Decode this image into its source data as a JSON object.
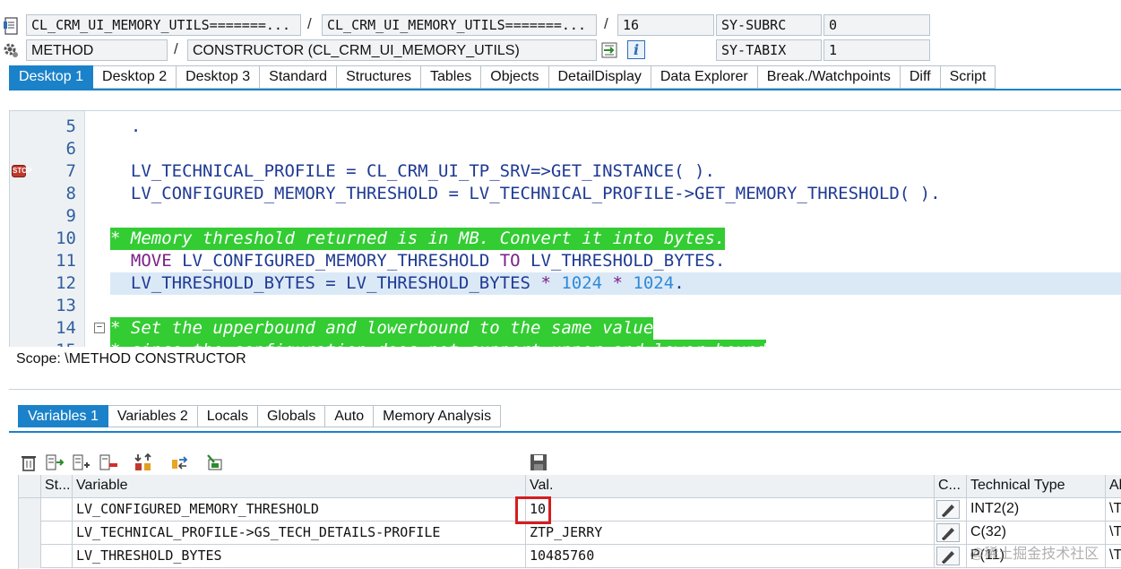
{
  "header": {
    "row1": {
      "program": "CL_CRM_UI_MEMORY_UTILS=======...",
      "include": "CL_CRM_UI_MEMORY_UTILS=======...",
      "line": "16",
      "sysvar1_name": "SY-SUBRC",
      "sysvar1_value": "0"
    },
    "row2": {
      "event_type": "METHOD",
      "event": "CONSTRUCTOR (CL_CRM_UI_MEMORY_UTILS)",
      "sysvar2_name": "SY-TABIX",
      "sysvar2_value": "1",
      "info_label": "i"
    },
    "separator": "/"
  },
  "desktop_tabs": [
    {
      "label": "Desktop 1",
      "active": true
    },
    {
      "label": "Desktop 2"
    },
    {
      "label": "Desktop 3"
    },
    {
      "label": "Standard"
    },
    {
      "label": "Structures"
    },
    {
      "label": "Tables"
    },
    {
      "label": "Objects"
    },
    {
      "label": "DetailDisplay"
    },
    {
      "label": "Data Explorer"
    },
    {
      "label": "Break./Watchpoints"
    },
    {
      "label": "Diff"
    },
    {
      "label": "Script"
    }
  ],
  "code": {
    "lines": [
      {
        "num": "5",
        "text": "  ."
      },
      {
        "num": "6",
        "text": ""
      },
      {
        "num": "7",
        "text": "  LV_TECHNICAL_PROFILE = CL_CRM_UI_TP_SRV=>GET_INSTANCE( )."
      },
      {
        "num": "8",
        "text": "  LV_CONFIGURED_MEMORY_THRESHOLD = LV_TECHNICAL_PROFILE->GET_MEMORY_THRESHOLD( )."
      },
      {
        "num": "9",
        "text": ""
      },
      {
        "num": "10",
        "text": "* Memory threshold returned is in MB. Convert it into bytes."
      },
      {
        "num": "11",
        "kw1": "MOVE",
        "mid": " LV_CONFIGURED_MEMORY_THRESHOLD ",
        "kw2": "TO",
        "end": " LV_THRESHOLD_BYTES."
      },
      {
        "num": "12",
        "pre": "  LV_THRESHOLD_BYTES = LV_THRESHOLD_BYTES ",
        "star1": "*",
        "n1": " 1024 ",
        "star2": "*",
        "n2": " 1024",
        "dot": "."
      },
      {
        "num": "13",
        "text": ""
      },
      {
        "num": "14",
        "text": "* Set the upperbound and lowerbound to the same value"
      },
      {
        "num": "15",
        "text": "* since the configuration does not support upper and lower bound"
      }
    ],
    "breakpoint_icon": "stop-sign"
  },
  "scope": "Scope: \\METHOD CONSTRUCTOR",
  "variable_tabs": [
    {
      "label": "Variables 1",
      "active": true
    },
    {
      "label": "Variables 2"
    },
    {
      "label": "Locals"
    },
    {
      "label": "Globals"
    },
    {
      "label": "Auto"
    },
    {
      "label": "Memory Analysis"
    }
  ],
  "table": {
    "headers": {
      "status": "St...",
      "variable": "Variable",
      "value": "Val.",
      "change": "C...",
      "technical_type": "Technical Type",
      "absolute_type": "Al"
    },
    "rows": [
      {
        "variable": "LV_CONFIGURED_MEMORY_THRESHOLD",
        "value": "10",
        "technical_type": "INT2(2)",
        "absolute_type": "\\T"
      },
      {
        "variable": "LV_TECHNICAL_PROFILE->GS_TECH_DETAILS-PROFILE",
        "value": "ZTP_JERRY",
        "technical_type": "C(32)",
        "absolute_type": "\\T"
      },
      {
        "variable": "LV_THRESHOLD_BYTES",
        "value": "10485760",
        "technical_type": "P(11)",
        "absolute_type": "\\T"
      }
    ]
  },
  "watermark": "@稀土掘金技术社区",
  "colors": {
    "accent": "#1b82c9",
    "comment_bg": "#33cc33",
    "keyword": "#7b1f87",
    "identifier": "#1f3a93",
    "number": "#2f8ad8",
    "highlight_box": "#d41e1e"
  }
}
